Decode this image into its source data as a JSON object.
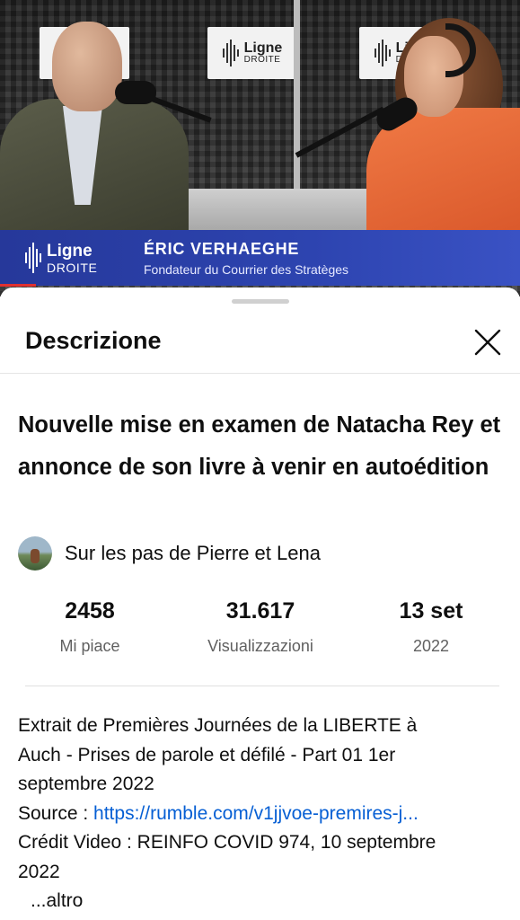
{
  "video": {
    "wall_logo_word": "Ligne",
    "wall_logo_sub": "DROITE",
    "lower_third": {
      "logo_word": "Ligne",
      "logo_sub": "DROITE",
      "name": "ÉRIC VERHAEGHE",
      "role": "Fondateur du Courrier des Stratèges",
      "color": "#2d44b0"
    }
  },
  "sheet": {
    "title": "Descrizione",
    "close_icon": "close-icon"
  },
  "video_title": "Nouvelle mise en examen de Natacha Rey et annonce de son livre à venir en autoédition",
  "channel": {
    "name": "Sur les pas de Pierre et Lena",
    "avatar_icon": "channel-avatar"
  },
  "stats": {
    "likes": {
      "value": "2458",
      "label": "Mi piace"
    },
    "views": {
      "value": "31.617",
      "label": "Visualizzazioni"
    },
    "date": {
      "value": "13 set",
      "label": "2022"
    }
  },
  "description": {
    "line1": "Extrait de Premières Journées de la LIBERTE à",
    "line2": "Auch - Prises de parole et défilé - Part 01 1er",
    "line3": "septembre 2022",
    "source_label": "Source : ",
    "source_link": "https://rumble.com/v1jjvoe-premires-j...",
    "credit_line1": "Crédit Video : REINFO COVID 974, 10 septembre",
    "credit_line2": "2022",
    "more_label": "...altro"
  },
  "colors": {
    "link": "#065fd4",
    "secondary_text": "#606060"
  }
}
